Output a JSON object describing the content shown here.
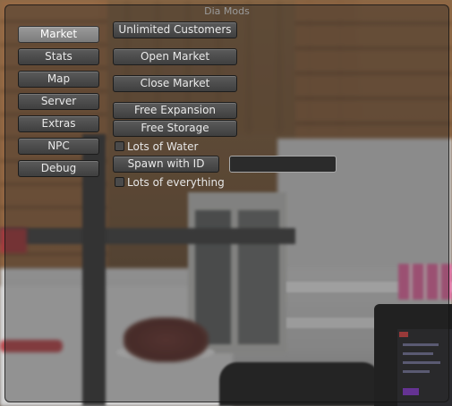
{
  "window": {
    "title": "Dia Mods"
  },
  "sidebar": {
    "items": [
      {
        "label": "Market",
        "active": true
      },
      {
        "label": "Stats",
        "active": false
      },
      {
        "label": "Map",
        "active": false
      },
      {
        "label": "Server",
        "active": false
      },
      {
        "label": "Extras",
        "active": false
      },
      {
        "label": "NPC",
        "active": false
      },
      {
        "label": "Debug",
        "active": false
      }
    ]
  },
  "market": {
    "unlimited_customers": "Unlimited Customers",
    "open_market": "Open Market",
    "close_market": "Close Market",
    "free_expansion": "Free Expansion",
    "free_storage": "Free Storage",
    "lots_of_water": "Lots of Water",
    "spawn_with_id": "Spawn with ID",
    "spawn_id_value": "",
    "lots_of_everything": "Lots of everything"
  },
  "colors": {
    "accent": "#8a8a8a",
    "panel": "#3f3f3f"
  }
}
